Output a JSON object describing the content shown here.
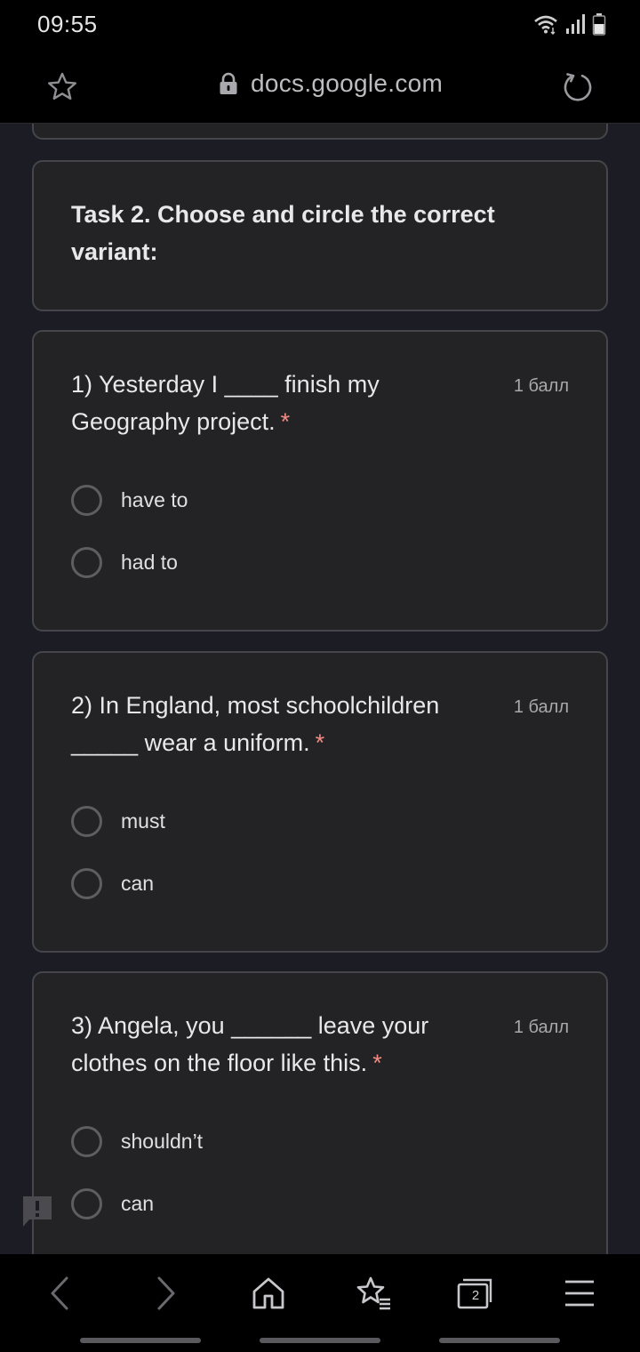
{
  "status_bar": {
    "time": "09:55"
  },
  "browser": {
    "url": "docs.google.com",
    "tab_count": "2"
  },
  "form": {
    "section_title": "Task 2. Choose and circle the correct variant:",
    "required_mark": "*",
    "questions": [
      {
        "text": "1) Yesterday I ____ finish my Geography project.",
        "points": "1 балл",
        "options": [
          "have to",
          "had to"
        ]
      },
      {
        "text": "2) In England, most schoolchildren _____ wear a uniform.",
        "points": "1 балл",
        "options": [
          "must",
          "can"
        ]
      },
      {
        "text": "3) Angela, you ______ leave your clothes on the floor like this.",
        "points": "1 балл",
        "options": [
          "shouldn’t",
          "can"
        ]
      }
    ]
  },
  "colors": {
    "background": "#1c1c24",
    "card": "#232325",
    "card_border": "#45454b",
    "required": "#f28b82"
  },
  "icons": [
    "wifi-icon",
    "signal-icon",
    "battery-icon",
    "star-icon",
    "lock-icon",
    "reload-icon",
    "feedback-icon",
    "back-icon",
    "forward-icon",
    "home-icon",
    "bookmarks-icon",
    "tabs-icon",
    "menu-icon"
  ]
}
